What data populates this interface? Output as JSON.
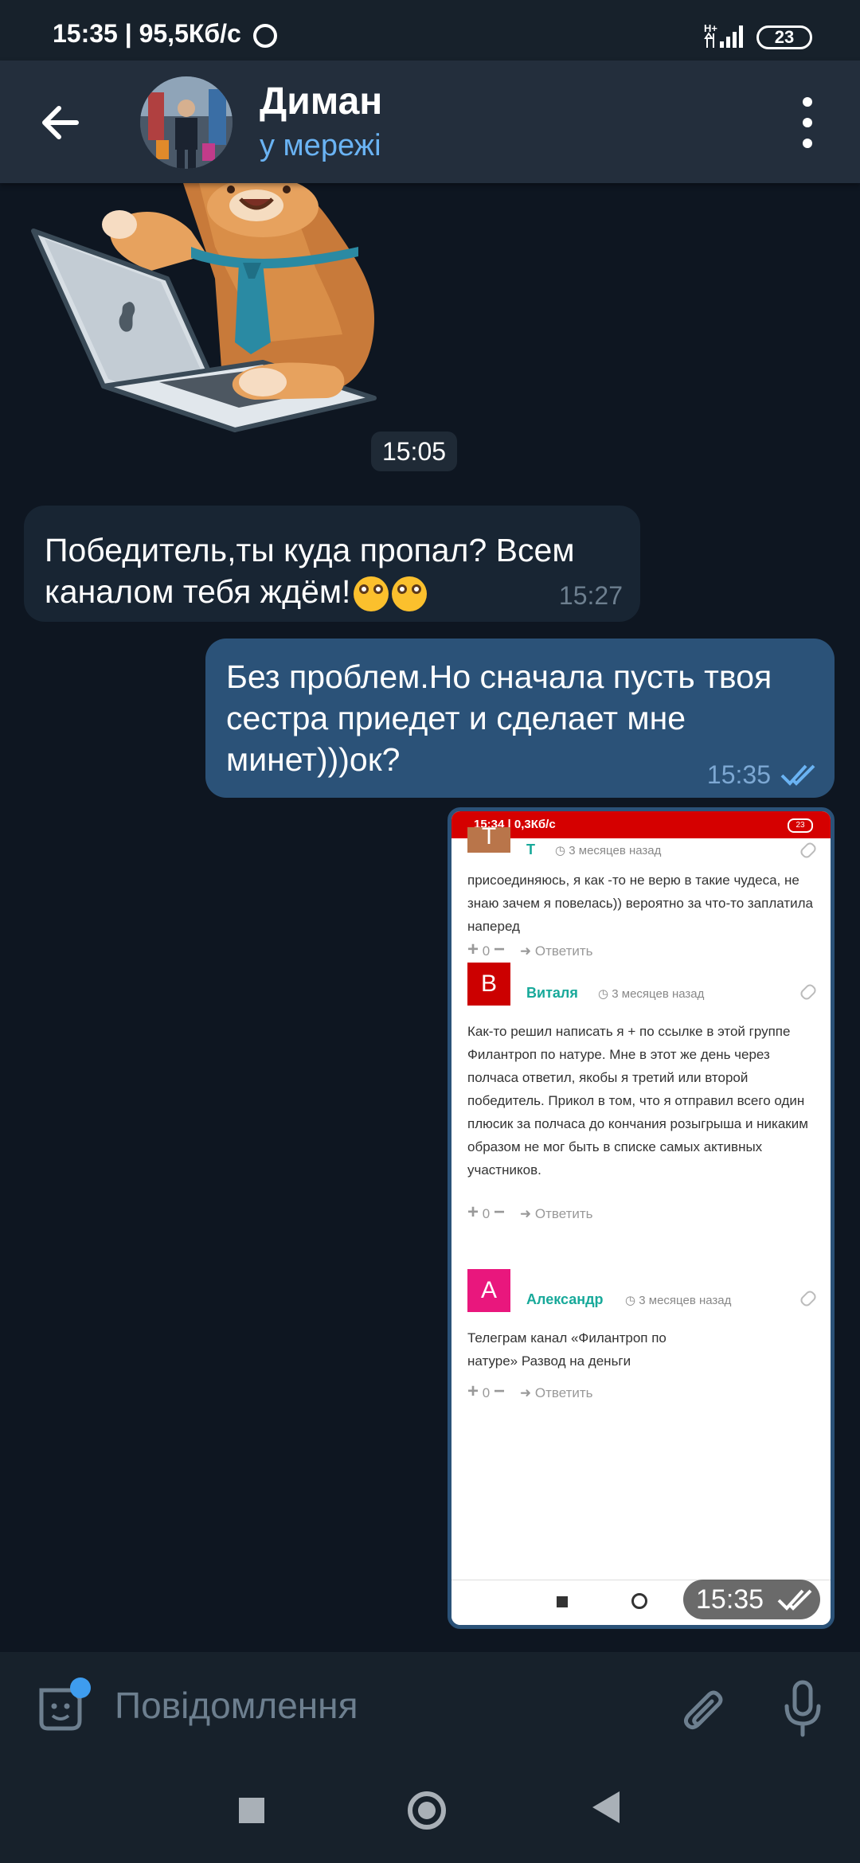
{
  "status_bar": {
    "time": "15:35 | 95,5Кб/с",
    "network": "H+",
    "battery": "23"
  },
  "header": {
    "name": "Диман",
    "status": "у мережі"
  },
  "chat": {
    "sticker_time": "15:05",
    "incoming": {
      "text": "Победитель,ты куда пропал? Всем каналом тебя ждём!",
      "emoji_count": 2,
      "time": "15:27"
    },
    "outgoing": {
      "text": "Без проблем.Но сначала пусть твоя сестра приедет и сделает мне минет)))ок?",
      "time": "15:35"
    },
    "screenshot_message": {
      "time": "15:35",
      "status_bar": {
        "time": "15:34 | 0,3Кб/с",
        "battery": "23"
      },
      "comments": [
        {
          "initial": "Т",
          "avatar_color": "#b9754a",
          "name": "Т",
          "date": "3 месяцев назад",
          "text": "присоединяюсь, я как -то не верю в такие чудеса, не знаю зачем я повелась)) вероятно за что-то заплатила наперед",
          "votes": "0",
          "reply": "Ответить"
        },
        {
          "initial": "В",
          "avatar_color": "#cc0000",
          "name": "Виталя",
          "date": "3 месяцев назад",
          "text": "Как-то решил написать я + по ссылке в этой группе Филантроп по натуре. Мне в этот же день через полчаса ответил, якобы я третий или второй победитель. Прикол в том, что я отправил всего один плюсик за полчаса до кончания розыгрыша и никаким образом не мог быть в списке самых активных участников.",
          "votes": "0",
          "reply": "Ответить"
        },
        {
          "initial": "А",
          "avatar_color": "#e9177d",
          "name": "Александр",
          "date": "3 месяцев назад",
          "text": "Телеграм канал «Филантроп по натуре» Развод на деньги",
          "votes": "0",
          "reply": "Ответить"
        }
      ]
    }
  },
  "input": {
    "placeholder": "Повідомлення"
  },
  "colors": {
    "accent": "#6ab3f3",
    "bubble_out": "#2b5278",
    "bubble_in": "#182533",
    "bg": "#0e1621"
  }
}
